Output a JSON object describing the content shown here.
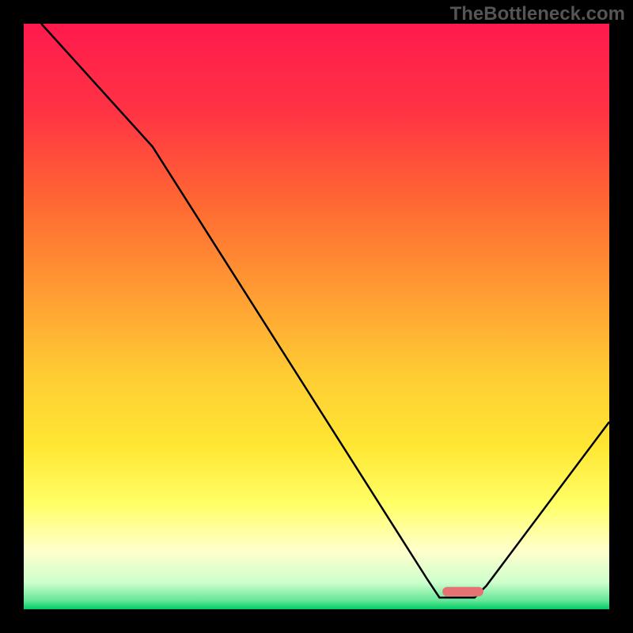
{
  "watermark": "TheBottleneck.com",
  "chart_data": {
    "type": "line",
    "title": "",
    "xlabel": "",
    "ylabel": "",
    "x_range": [
      0,
      100
    ],
    "y_range": [
      0,
      100
    ],
    "background": {
      "type": "vertical-gradient",
      "stops": [
        {
          "offset": 0.0,
          "color": "#ff1a4d"
        },
        {
          "offset": 0.15,
          "color": "#ff3344"
        },
        {
          "offset": 0.3,
          "color": "#ff6633"
        },
        {
          "offset": 0.45,
          "color": "#ff9933"
        },
        {
          "offset": 0.6,
          "color": "#ffcc33"
        },
        {
          "offset": 0.72,
          "color": "#ffe633"
        },
        {
          "offset": 0.82,
          "color": "#ffff66"
        },
        {
          "offset": 0.9,
          "color": "#ffffcc"
        },
        {
          "offset": 0.955,
          "color": "#ccffcc"
        },
        {
          "offset": 0.985,
          "color": "#66e699"
        },
        {
          "offset": 1.0,
          "color": "#00cc66"
        }
      ]
    },
    "curve": {
      "description": "bottleneck percentage vs component position (V-shaped)",
      "points": [
        {
          "x": 3,
          "y": 100
        },
        {
          "x": 22,
          "y": 79
        },
        {
          "x": 69,
          "y": 5
        },
        {
          "x": 71,
          "y": 2
        },
        {
          "x": 77,
          "y": 2
        },
        {
          "x": 79,
          "y": 4
        },
        {
          "x": 100,
          "y": 32
        }
      ]
    },
    "marker": {
      "description": "optimal/no-bottleneck region",
      "x_center": 75,
      "y": 3,
      "width": 7,
      "color": "#e57373"
    },
    "frame_color": "#000000"
  }
}
